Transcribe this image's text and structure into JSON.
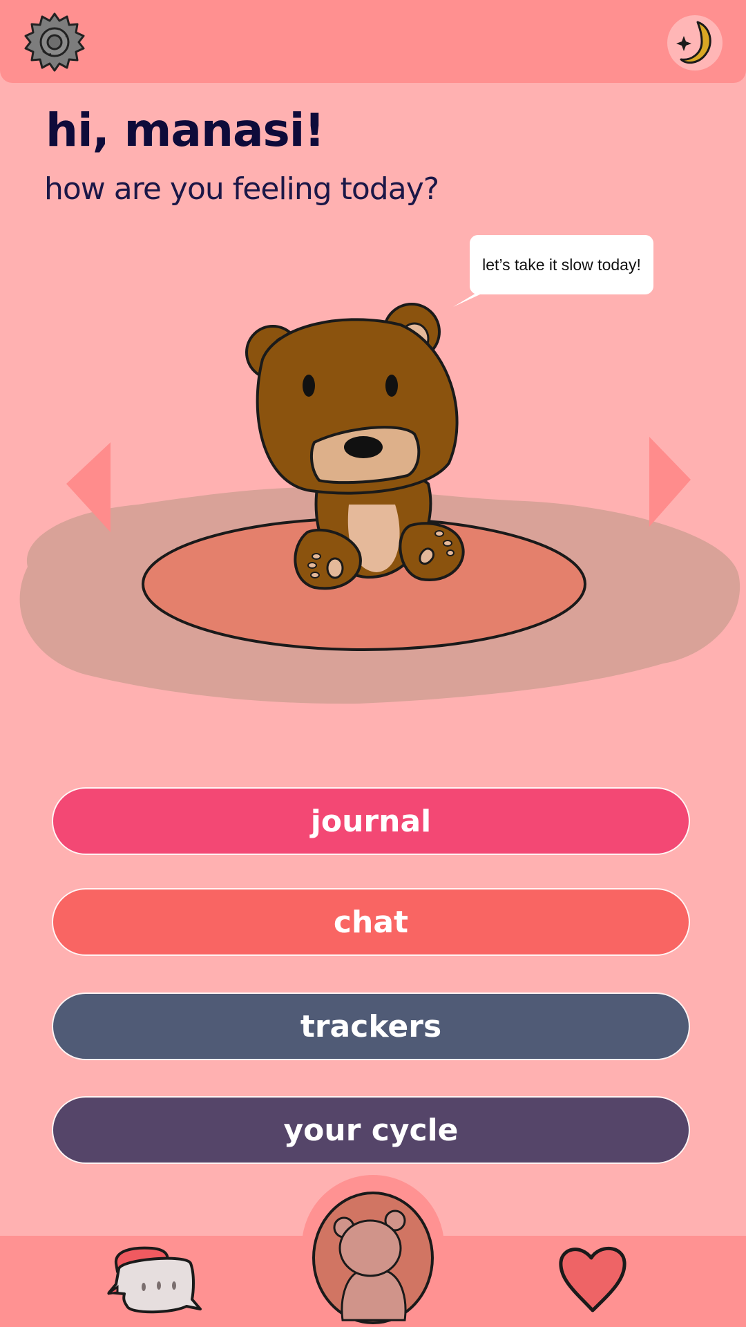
{
  "header": {
    "settings_icon": "gear-icon",
    "theme_icon": "moon-star-icon"
  },
  "greeting": {
    "title": "hi, manasi!",
    "subtitle": "how are you feeling today?"
  },
  "companion": {
    "speech": "let’s take it slow today!",
    "character": "teddy-bear",
    "prev_icon": "triangle-left-icon",
    "next_icon": "triangle-right-icon"
  },
  "menu": [
    {
      "label": "journal",
      "color": "#F34874"
    },
    {
      "label": "chat",
      "color": "#F96563"
    },
    {
      "label": "trackers",
      "color": "#505B76"
    },
    {
      "label": "your cycle",
      "color": "#554569"
    }
  ],
  "bottom_nav": [
    {
      "icon": "speech-bubble-icon"
    },
    {
      "icon": "bear-avatar-icon"
    },
    {
      "icon": "heart-icon"
    }
  ],
  "colors": {
    "background": "#FFB1B1",
    "bar": "#FF9090",
    "text_dark": "#0E0B3A",
    "rug": "#E4806C",
    "shadow": "#D9A298",
    "bear": "#8B530E",
    "bear_light": "#DDB08A"
  }
}
